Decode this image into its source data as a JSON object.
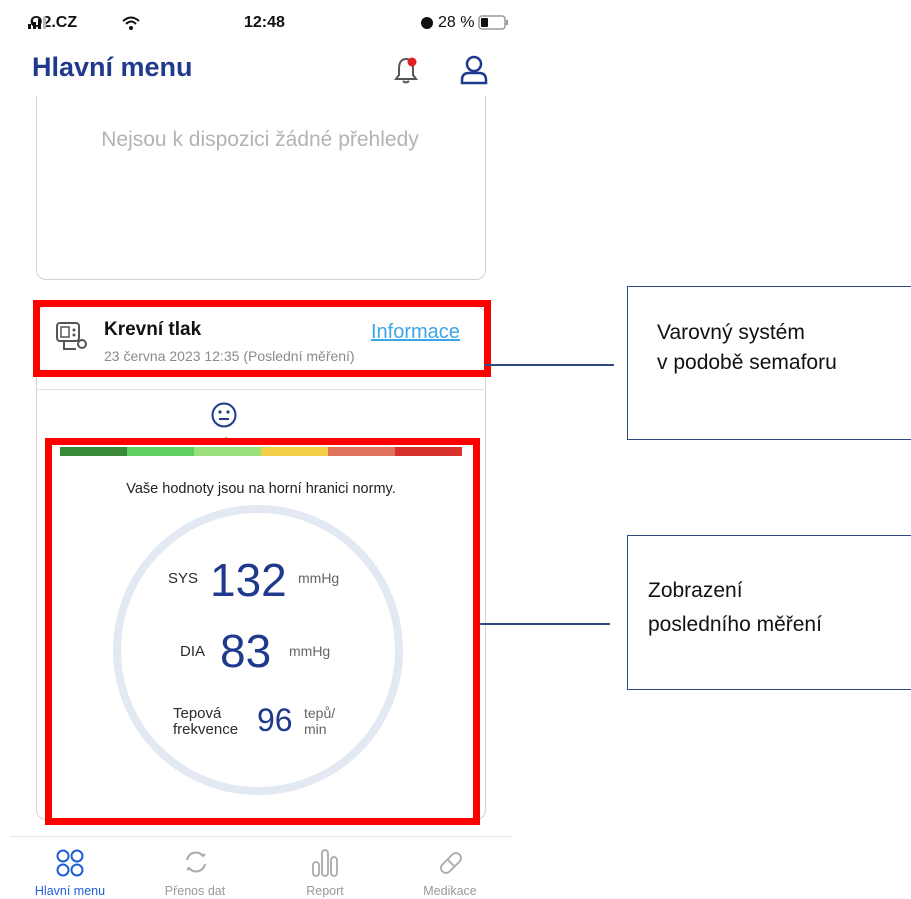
{
  "status_bar": {
    "carrier": "O2.CZ",
    "time": "12:48",
    "battery": "28 %"
  },
  "header": {
    "title": "Hlavní menu",
    "notification_icon": "bell-icon",
    "profile_icon": "user-icon"
  },
  "overview": {
    "empty_text": "Nejsou k dispozici žádné přehledy"
  },
  "blood_pressure": {
    "title": "Krevní tlak",
    "subtitle": "23 června 2023 12:35 (Poslední měření)",
    "info_link": "Informace",
    "status_icon": "neutral-face-icon",
    "scale_colors": [
      "#3a8a3a",
      "#5fcf5f",
      "#9be07a",
      "#f3cf4a",
      "#e0715a",
      "#d9312b"
    ],
    "message": "Vaše hodnoty jsou na horní hranici normy.",
    "sys": {
      "label": "SYS",
      "value": "132",
      "unit": "mmHg"
    },
    "dia": {
      "label": "DIA",
      "value": "83",
      "unit": "mmHg"
    },
    "pulse": {
      "label_line1": "Tepová",
      "label_line2": "frekvence",
      "value": "96",
      "unit_line1": "tepů/",
      "unit_line2": "min"
    }
  },
  "nav": [
    {
      "label": "Hlavní menu",
      "icon": "grid-icon",
      "active": true
    },
    {
      "label": "Přenos dat",
      "icon": "sync-icon",
      "active": false
    },
    {
      "label": "Report",
      "icon": "bars-icon",
      "active": false
    },
    {
      "label": "Medikace",
      "icon": "pill-icon",
      "active": false
    }
  ],
  "annotations": {
    "warning": {
      "line1": "Varovný systém",
      "line2": "v podobě semaforu"
    },
    "display": {
      "line1": "Zobrazení",
      "line2": "posledního měření"
    }
  },
  "colors": {
    "accent": "#1f3a8c",
    "link": "#3da6e6",
    "annotation_red": "#ff0000",
    "annotation_blue": "#2f4a80"
  }
}
